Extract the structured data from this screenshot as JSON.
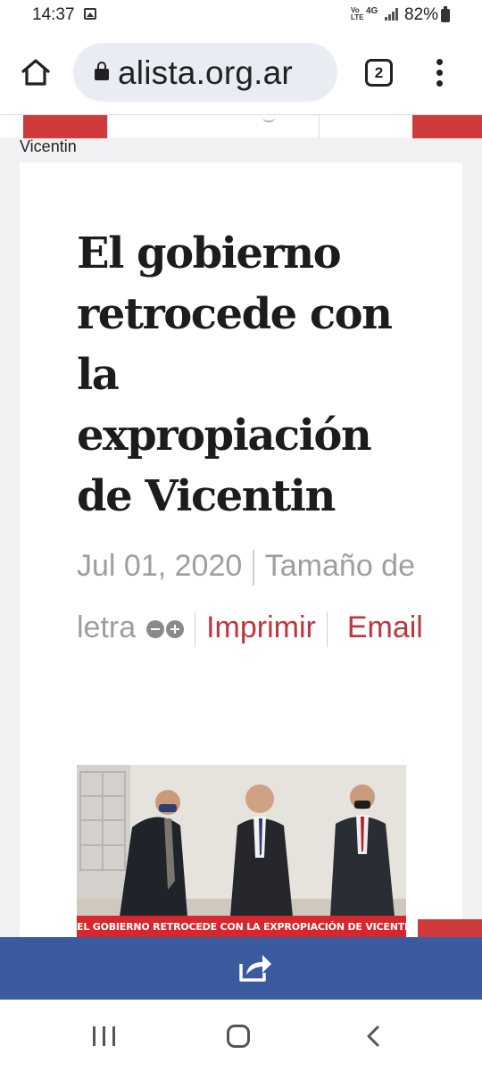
{
  "status_bar": {
    "time": "14:37",
    "volte_label": "Vo LTE",
    "network_label": "4G",
    "battery_percent": "82%"
  },
  "browser": {
    "url_text": "alista.org.ar",
    "tab_count": "2"
  },
  "breadcrumb": "Vicentin",
  "article": {
    "title": "El gobierno retrocede con la expropiación de Vicentin",
    "date": "Jul 01, 2020",
    "font_size_label": "Tamaño de letra",
    "print_label": "Imprimir",
    "email_label": "Email",
    "image_caption": "EL GOBIERNO RETROCEDE CON LA EXPROPIACIÓN DE VICENTIN"
  },
  "colors": {
    "accent_red": "#c1343b",
    "share_bar": "#3a5ba0",
    "caption_red": "#d7262c"
  },
  "icons": {
    "home": "home-icon",
    "lock": "lock-icon",
    "menu": "more-vert-icon",
    "share": "share-icon",
    "nav_recent": "recent-apps-icon",
    "nav_home": "nav-home-icon",
    "nav_back": "nav-back-icon"
  }
}
